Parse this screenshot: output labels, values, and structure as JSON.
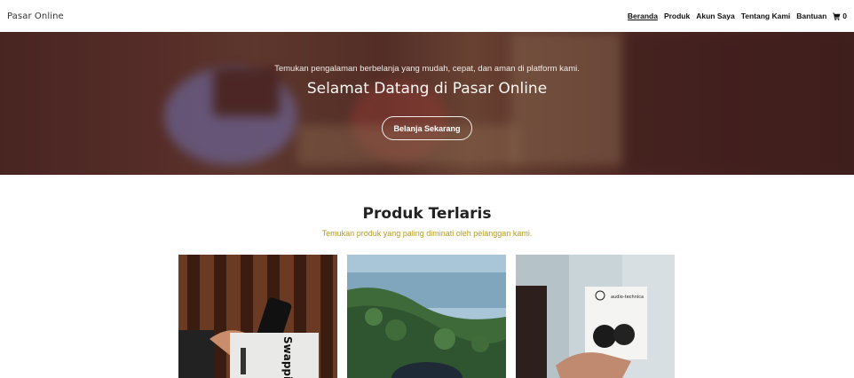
{
  "brand": "Pasar Online",
  "nav": {
    "items": [
      {
        "label": "Beranda",
        "active": true
      },
      {
        "label": "Produk",
        "active": false
      },
      {
        "label": "Akun Saya",
        "active": false
      },
      {
        "label": "Tentang Kami",
        "active": false
      },
      {
        "label": "Bantuan",
        "active": false
      }
    ],
    "cart_icon": "shopping-cart-icon",
    "cart_count": "0"
  },
  "hero": {
    "subtitle": "Temukan pengalaman berbelanja yang mudah, cepat, dan aman di platform kami.",
    "title": "Selamat Datang di Pasar Online",
    "button_label": "Belanja Sekarang"
  },
  "bestsellers": {
    "title": "Produk Terlaris",
    "subtitle": "Temukan produk yang paling diminati oleh pelanggan kami.",
    "accent_color": "#b39b1e",
    "products": [
      {
        "image": "smartphone-box-photo",
        "box_text": "Swappie"
      },
      {
        "image": "coastal-landscape-photo"
      },
      {
        "image": "earbuds-box-photo",
        "box_text": "audio-technica"
      }
    ]
  }
}
